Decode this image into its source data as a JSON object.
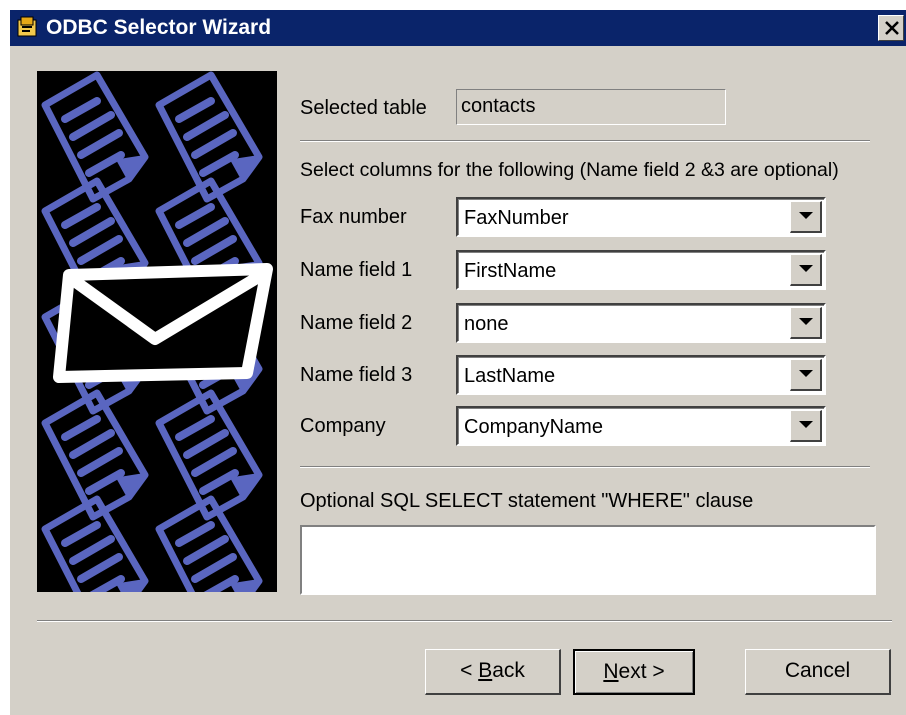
{
  "window": {
    "title": "ODBC Selector Wizard",
    "close_symbol": "×"
  },
  "form": {
    "selected_table_label": "Selected table",
    "selected_table_value": "contacts",
    "instruction": "Select columns for the following (Name field 2 &3 are optional)",
    "fields": [
      {
        "label": "Fax number",
        "value": "FaxNumber"
      },
      {
        "label": "Name field 1",
        "value": "FirstName"
      },
      {
        "label": "Name field 2",
        "value": "none"
      },
      {
        "label": "Name field 3",
        "value": "LastName"
      },
      {
        "label": "Company",
        "value": "CompanyName"
      }
    ],
    "where_label": "Optional SQL SELECT statement \"WHERE\" clause",
    "where_value": ""
  },
  "buttons": {
    "back": {
      "prefix": "< ",
      "mnemonic": "B",
      "rest": "ack"
    },
    "next": {
      "prefix": "",
      "mnemonic": "N",
      "rest": "ext >"
    },
    "cancel": "Cancel"
  },
  "icons": {
    "title": "wizard-app-icon",
    "artwork": "envelope-over-documents-art",
    "dropdown": "dropdown-arrow-icon"
  },
  "colors": {
    "titlebar": "#0a246a",
    "dialog_face": "#d4d0c8",
    "art_background": "#000000",
    "art_documents": "#5a66c0"
  }
}
